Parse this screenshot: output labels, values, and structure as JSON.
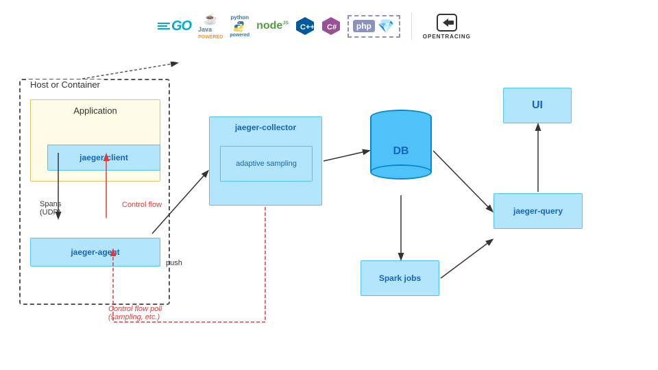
{
  "logos": {
    "go": "GO",
    "java": "Java",
    "python": "python",
    "node": "node",
    "cpp": "C++",
    "csharp": "C#",
    "php": "php",
    "ruby": "●",
    "opentracing": "OPENTRACING"
  },
  "diagram": {
    "host_label": "Host or Container",
    "app_label": "Application",
    "jaeger_client": "jaeger-client",
    "jaeger_agent": "jaeger-agent",
    "jaeger_collector": "jaeger-collector",
    "adaptive_sampling": "adaptive sampling",
    "db": "DB",
    "spark_jobs": "Spark jobs",
    "jaeger_query": "jaeger-query",
    "ui": "UI",
    "spans_udp": "Spans\n(UDP)",
    "control_flow": "Control flow",
    "push_label": "push",
    "control_flow_poll": "Control flow poll\n(sampling, etc.)"
  }
}
